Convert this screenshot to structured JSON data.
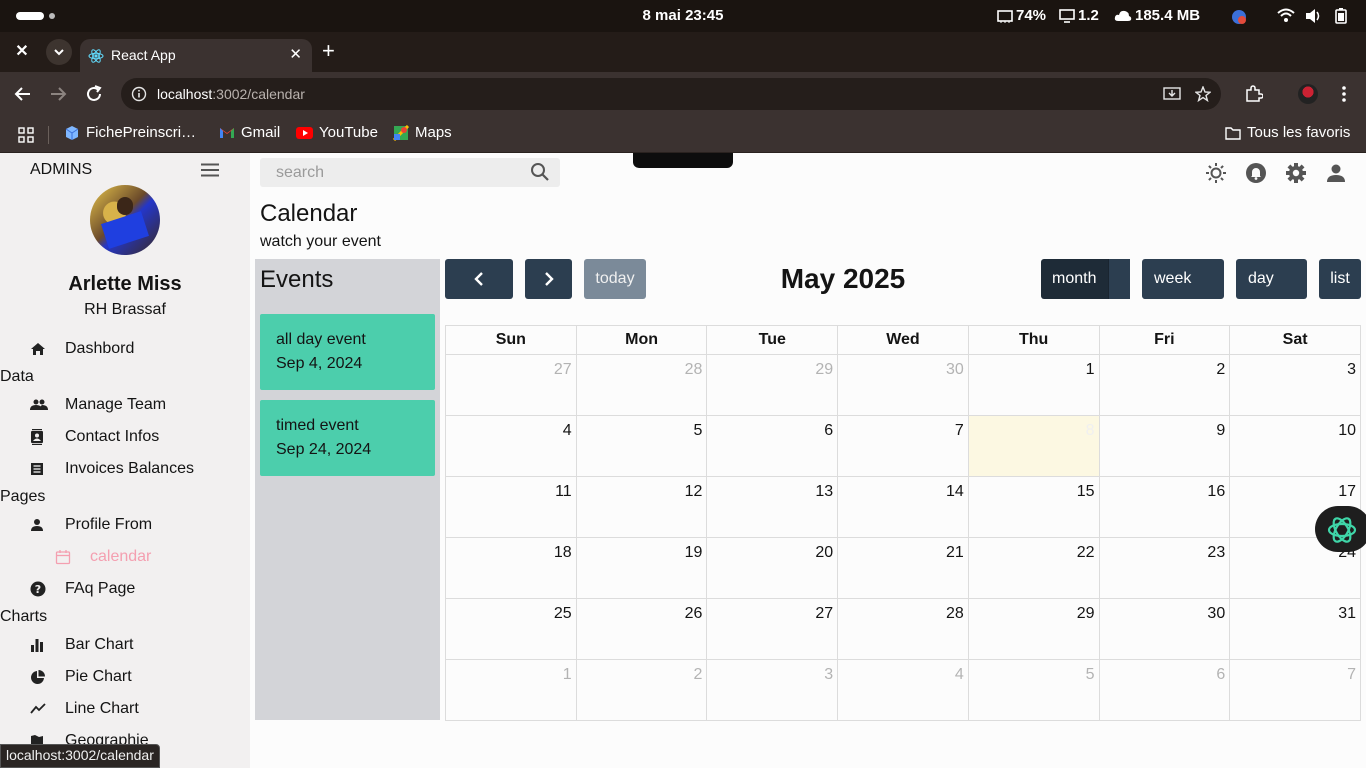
{
  "os_bar": {
    "date_time": "8 mai  23:45",
    "battery_pct": "74%",
    "cpu": "1.2",
    "memory": "185.4 MB"
  },
  "browser": {
    "tab_title": "React App",
    "url_host": "localhost",
    "url_path": ":3002/calendar",
    "bookmarks": [
      "FichePreinscri…",
      "Gmail",
      "YouTube",
      "Maps"
    ],
    "all_bookmarks": "Tous les favoris",
    "status_tooltip": "localhost:3002/calendar"
  },
  "sidebar": {
    "brand": "ADMINS",
    "user_name": "Arlette Miss",
    "user_role": "RH Brassaf",
    "dashboard": "Dashbord",
    "section_data": "Data",
    "manage_team": "Manage Team",
    "contact_infos": "Contact Infos",
    "invoices": "Invoices Balances",
    "section_pages": "Pages",
    "profile_form": "Profile From",
    "calendar": "calendar",
    "faq": "FAq Page",
    "section_charts": "Charts",
    "bar_chart": "Bar Chart",
    "pie_chart": "Pie Chart",
    "line_chart": "Line Chart",
    "geographie": "Geographie"
  },
  "topbar": {
    "search_placeholder": "search"
  },
  "page": {
    "title": "Calendar",
    "subtitle": "watch your event"
  },
  "events_panel": {
    "heading": "Events",
    "events": [
      {
        "title": "all day event",
        "date": "Sep 4, 2024"
      },
      {
        "title": "timed event",
        "date": "Sep 24, 2024"
      }
    ]
  },
  "calendar": {
    "title": "May 2025",
    "today_label": "today",
    "views": {
      "month": "month",
      "week": "week",
      "day": "day",
      "list": "list"
    },
    "active_view": "month",
    "weekdays": [
      "Sun",
      "Mon",
      "Tue",
      "Wed",
      "Thu",
      "Fri",
      "Sat"
    ],
    "weeks": [
      [
        "27",
        "28",
        "29",
        "30",
        "1",
        "2",
        "3"
      ],
      [
        "4",
        "5",
        "6",
        "7",
        "8",
        "9",
        "10"
      ],
      [
        "11",
        "12",
        "13",
        "14",
        "15",
        "16",
        "17"
      ],
      [
        "18",
        "19",
        "20",
        "21",
        "22",
        "23",
        "24"
      ],
      [
        "25",
        "26",
        "27",
        "28",
        "29",
        "30",
        "31"
      ],
      [
        "1",
        "2",
        "3",
        "4",
        "5",
        "6",
        "7"
      ]
    ],
    "today_date": "8",
    "colors": {
      "button": "#2c3e50",
      "event": "#4cceac",
      "today_cell": "#fcf8e2",
      "active_nav": "#f49fb0"
    }
  }
}
